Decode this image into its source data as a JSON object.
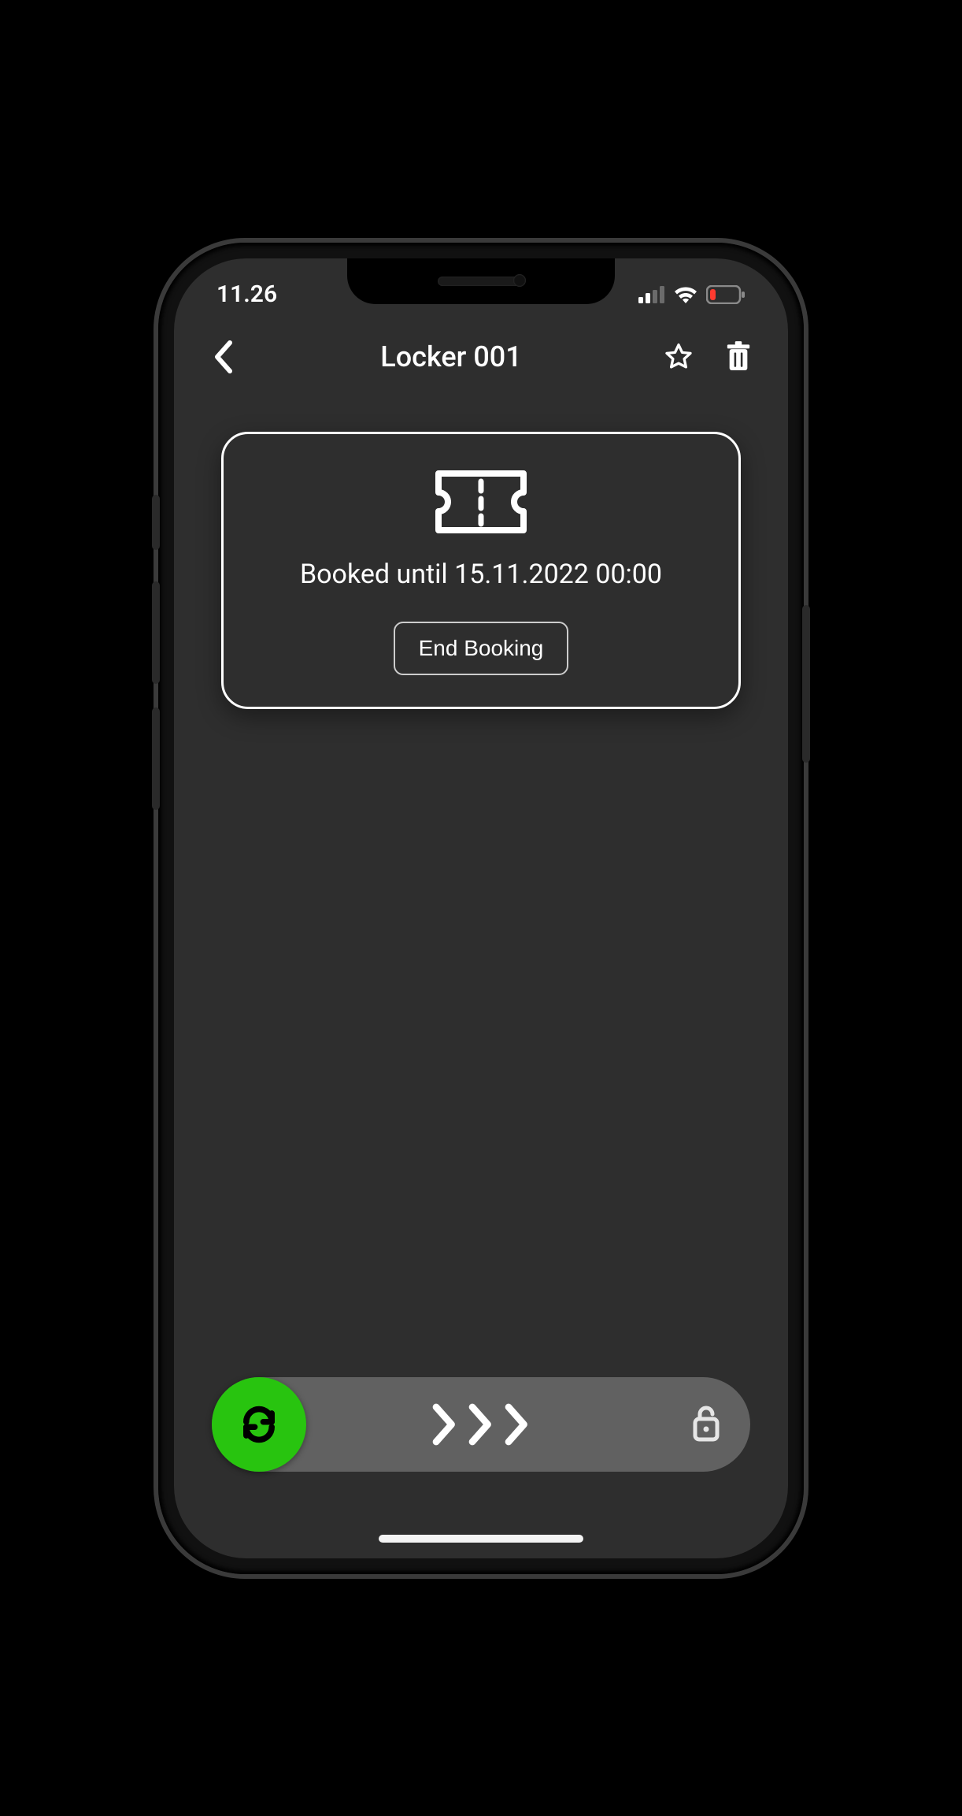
{
  "status_bar": {
    "time": "11.26",
    "signal_level": 2,
    "wifi": true,
    "battery_low": true
  },
  "header": {
    "title": "Locker 001",
    "icons": {
      "back": "chevron-left-icon",
      "favorite": "star-outline-icon",
      "delete": "trash-icon"
    }
  },
  "booking": {
    "icon": "ticket-icon",
    "status_text": "Booked until 15.11.2022 00:00",
    "end_button_label": "End Booking"
  },
  "slider": {
    "knob_icon": "sync-icon",
    "chevron_icon": "chevron-right-icon",
    "target_icon": "unlock-icon",
    "accent_color": "#28c40f"
  }
}
